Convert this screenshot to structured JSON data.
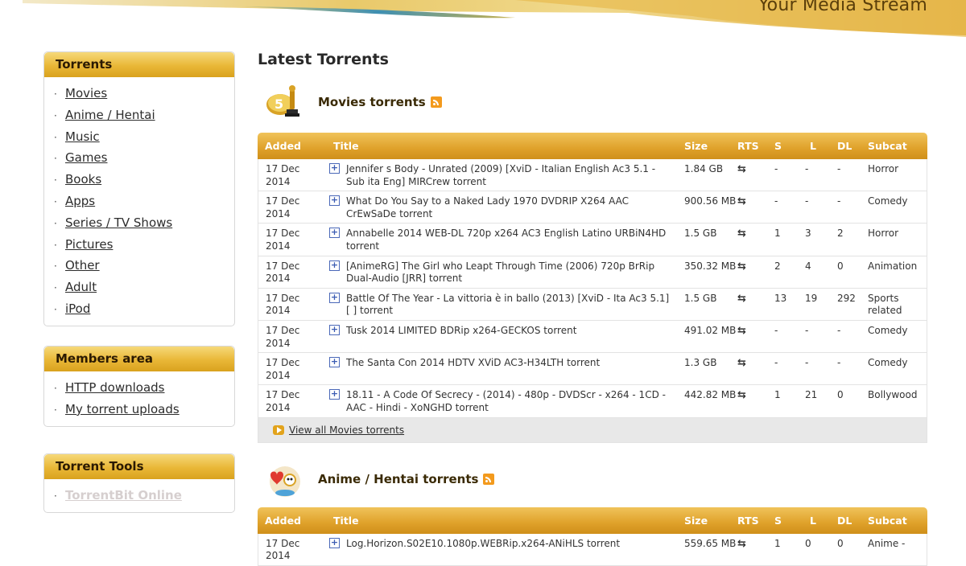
{
  "header": {
    "tagline": "Your Media Stream"
  },
  "sidebar": {
    "torrents": {
      "title": "Torrents",
      "items": [
        "Movies",
        "Anime / Hentai",
        "Music",
        "Games",
        "Books",
        "Apps",
        "Series / TV Shows",
        "Pictures",
        "Other",
        "Adult",
        "iPod"
      ]
    },
    "members": {
      "title": "Members area",
      "items": [
        "HTTP downloads",
        "My torrent uploads"
      ]
    },
    "tools": {
      "title": "Torrent Tools",
      "items": [
        "TorrentBit Online"
      ]
    }
  },
  "main": {
    "title": "Latest Torrents",
    "columns": [
      "Added",
      "Title",
      "Size",
      "RTS",
      "S",
      "L",
      "DL",
      "Subcat"
    ],
    "plus_symbol": "+",
    "rts_symbol": "⇆",
    "sections": [
      {
        "title": "Movies torrents",
        "icon": "movie-award-icon",
        "view_all": "View all Movies torrents",
        "rows": [
          {
            "added": "17 Dec 2014",
            "title": "Jennifer s Body - Unrated (2009) [XviD - Italian English Ac3 5.1 - Sub ita Eng] MIRCrew torrent",
            "size": "1.84 GB",
            "s": "-",
            "l": "-",
            "dl": "-",
            "subcat": "Horror"
          },
          {
            "added": "17 Dec 2014",
            "title": "What Do You Say to a Naked Lady 1970 DVDRIP X264 AAC CrEwSaDe torrent",
            "size": "900.56 MB",
            "s": "-",
            "l": "-",
            "dl": "-",
            "subcat": "Comedy"
          },
          {
            "added": "17 Dec 2014",
            "title": "Annabelle 2014 WEB-DL 720p x264 AC3 English Latino URBiN4HD torrent",
            "size": "1.5 GB",
            "s": "1",
            "l": "3",
            "dl": "2",
            "subcat": "Horror"
          },
          {
            "added": "17 Dec 2014",
            "title": "[AnimeRG] The Girl who Leapt Through Time (2006) 720p BrRip Dual-Audio [JRR] torrent",
            "size": "350.32 MB",
            "s": "2",
            "l": "4",
            "dl": "0",
            "subcat": "Animation"
          },
          {
            "added": "17 Dec 2014",
            "title": "Battle Of The Year - La vittoria è in ballo (2013) [XviD - Ita Ac3 5.1][ ] torrent",
            "size": "1.5 GB",
            "s": "13",
            "l": "19",
            "dl": "292",
            "subcat": "Sports related"
          },
          {
            "added": "17 Dec 2014",
            "title": "Tusk 2014 LIMITED BDRip x264-GECKOS torrent",
            "size": "491.02 MB",
            "s": "-",
            "l": "-",
            "dl": "-",
            "subcat": "Comedy"
          },
          {
            "added": "17 Dec 2014",
            "title": "The Santa Con 2014 HDTV XViD AC3-H34LTH torrent",
            "size": "1.3 GB",
            "s": "-",
            "l": "-",
            "dl": "-",
            "subcat": "Comedy"
          },
          {
            "added": "17 Dec 2014",
            "title": "18.11 - A Code Of Secrecy - (2014) - 480p - DVDScr - x264 - 1CD - AAC - Hindi - XoNGHD torrent",
            "size": "442.82 MB",
            "s": "1",
            "l": "21",
            "dl": "0",
            "subcat": "Bollywood"
          }
        ]
      },
      {
        "title": "Anime / Hentai torrents",
        "icon": "anime-heart-icon",
        "rows": [
          {
            "added": "17 Dec 2014",
            "title": "Log.Horizon.S02E10.1080p.WEBRip.x264-ANiHLS torrent",
            "size": "559.65 MB",
            "s": "1",
            "l": "0",
            "dl": "0",
            "subcat": "Anime -"
          }
        ]
      }
    ]
  }
}
